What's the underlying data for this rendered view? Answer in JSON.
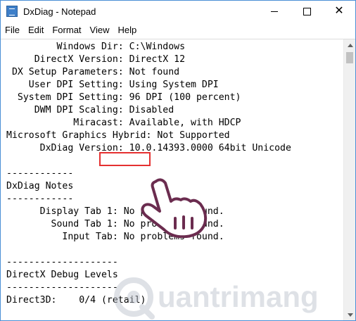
{
  "window": {
    "title": "DxDiag - Notepad",
    "controls": {
      "minimize": "minimize",
      "maximize": "maximize",
      "close": "✕"
    }
  },
  "menu": [
    "File",
    "Edit",
    "Format",
    "View",
    "Help"
  ],
  "document": {
    "lines": [
      "         Windows Dir: C:\\Windows",
      "     DirectX Version: DirectX 12",
      " DX Setup Parameters: Not found",
      "    User DPI Setting: Using System DPI",
      "  System DPI Setting: 96 DPI (100 percent)",
      "     DWM DPI Scaling: Disabled",
      "            Miracast: Available, with HDCP",
      "Microsoft Graphics Hybrid: Not Supported",
      "      DxDiag Version: 10.0.14393.0000 64bit Unicode",
      "",
      "------------",
      "DxDiag Notes",
      "------------",
      "      Display Tab 1: No problems found.",
      "        Sound Tab 1: No problems found.",
      "          Input Tab: No problems found.",
      "",
      "--------------------",
      "DirectX Debug Levels",
      "--------------------",
      "Direct3D:    0/4 (retail)"
    ]
  },
  "highlight": {
    "label": "Miracast:",
    "color": "#e53030"
  },
  "watermark": {
    "text": "uantrimang"
  },
  "colors": {
    "window_border": "#4a8fd6",
    "scroll_thumb": "#c1c1c1"
  }
}
